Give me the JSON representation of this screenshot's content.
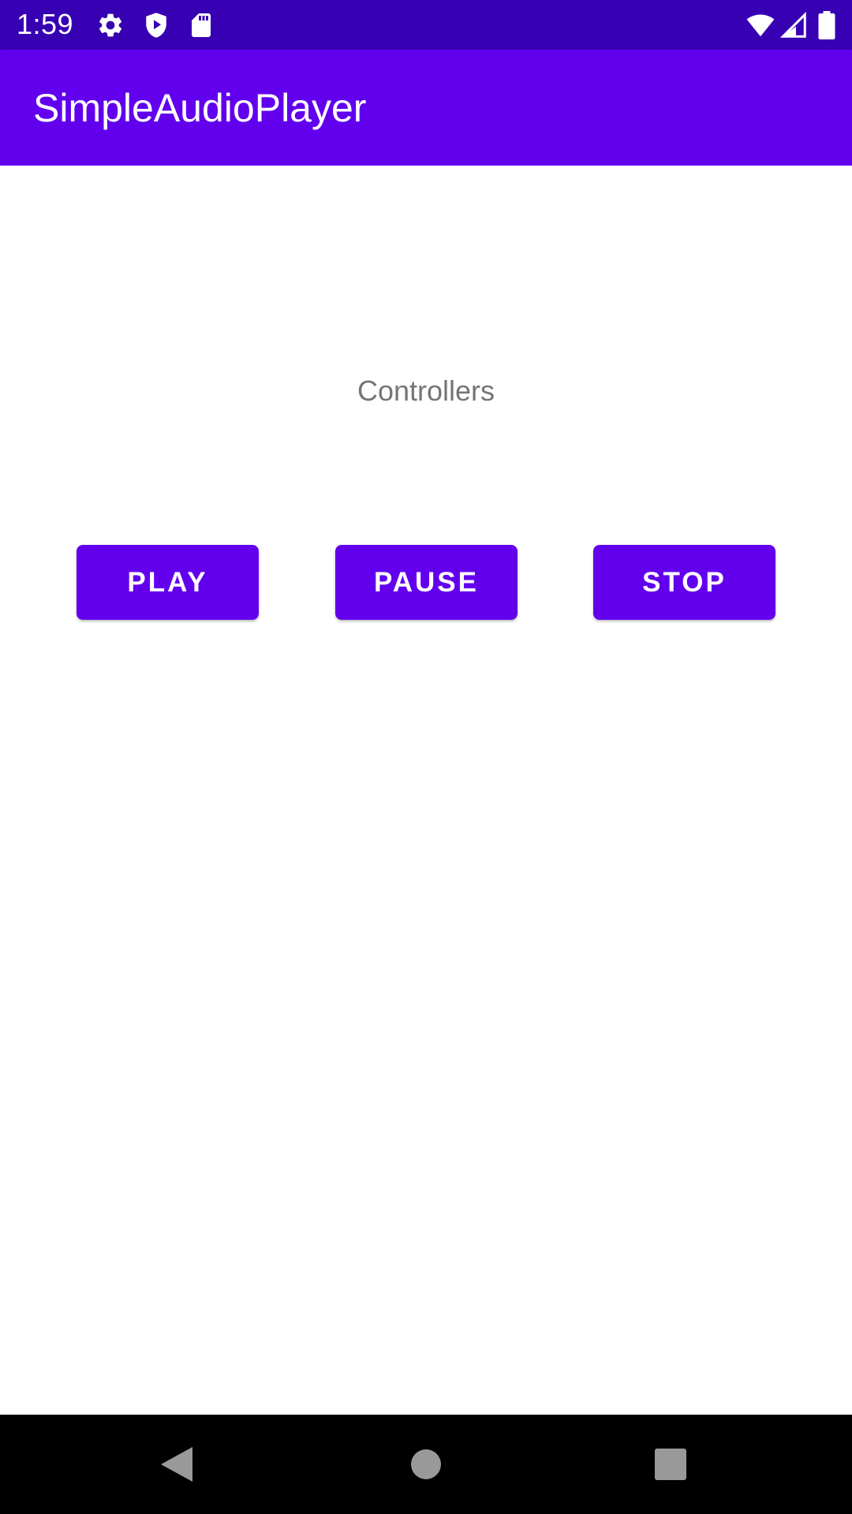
{
  "status_bar": {
    "time": "1:59",
    "background": "#3700b3",
    "left_icons": [
      "gear-icon",
      "shield-play-icon",
      "sd-card-icon"
    ],
    "right_icons": [
      "wifi-icon",
      "cell-signal-icon",
      "battery-icon"
    ]
  },
  "app_bar": {
    "title": "SimpleAudioPlayer",
    "background": "#6200ee"
  },
  "main": {
    "label": "Controllers",
    "buttons": [
      {
        "label": "PLAY"
      },
      {
        "label": "PAUSE"
      },
      {
        "label": "STOP"
      }
    ],
    "button_color": "#6200ee"
  },
  "nav_bar": {
    "buttons": [
      "back-icon",
      "home-icon",
      "recents-icon"
    ]
  }
}
